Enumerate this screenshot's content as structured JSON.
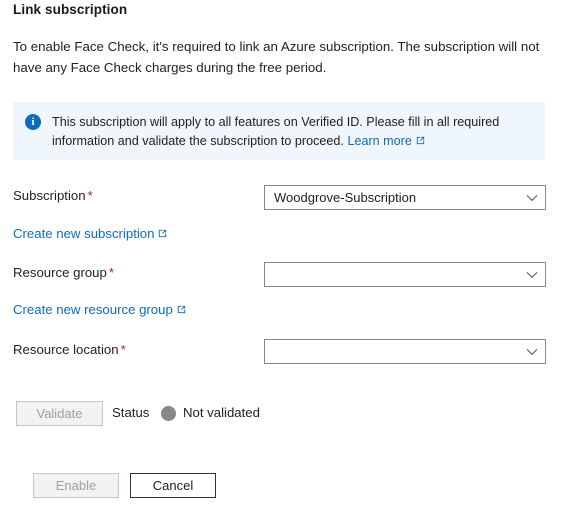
{
  "panel": {
    "title": "Link subscription",
    "intro": "To enable Face Check, it's required to link an Azure subscription. The subscription will not have any Face Check charges during the free period."
  },
  "info_banner": {
    "icon": "info-icon",
    "text": "This subscription will apply to all features on Verified ID. Please fill in all required information and validate the subscription to proceed.",
    "link_label": "Learn more",
    "link_icon": "external-link-icon",
    "background_color": "#eff6fc",
    "icon_color": "#0f6cbd"
  },
  "form": {
    "required_marker": "*",
    "required_color": "#a4262c",
    "fields": [
      {
        "label": "Subscription",
        "required": true,
        "value": "Woodgrove-Subscription",
        "placeholder": "",
        "create_link": "Create new subscription",
        "create_link_icon": "external-link-icon"
      },
      {
        "label": "Resource group",
        "required": true,
        "value": "",
        "placeholder": "",
        "create_link": "Create new resource group",
        "create_link_icon": "external-link-icon"
      },
      {
        "label": "Resource location",
        "required": true,
        "value": "",
        "placeholder": "",
        "create_link": "",
        "create_link_icon": ""
      }
    ]
  },
  "validation": {
    "validate_button": "Validate",
    "validate_disabled": true,
    "status_label": "Status",
    "status_text": "Not validated",
    "status_dot_color": "#8a8886"
  },
  "footer": {
    "enable_button": "Enable",
    "enable_disabled": true,
    "cancel_button": "Cancel"
  },
  "theme": {
    "link_color": "#0f6cbd",
    "text_color": "#201f1e",
    "border_color": "#8a8886"
  }
}
